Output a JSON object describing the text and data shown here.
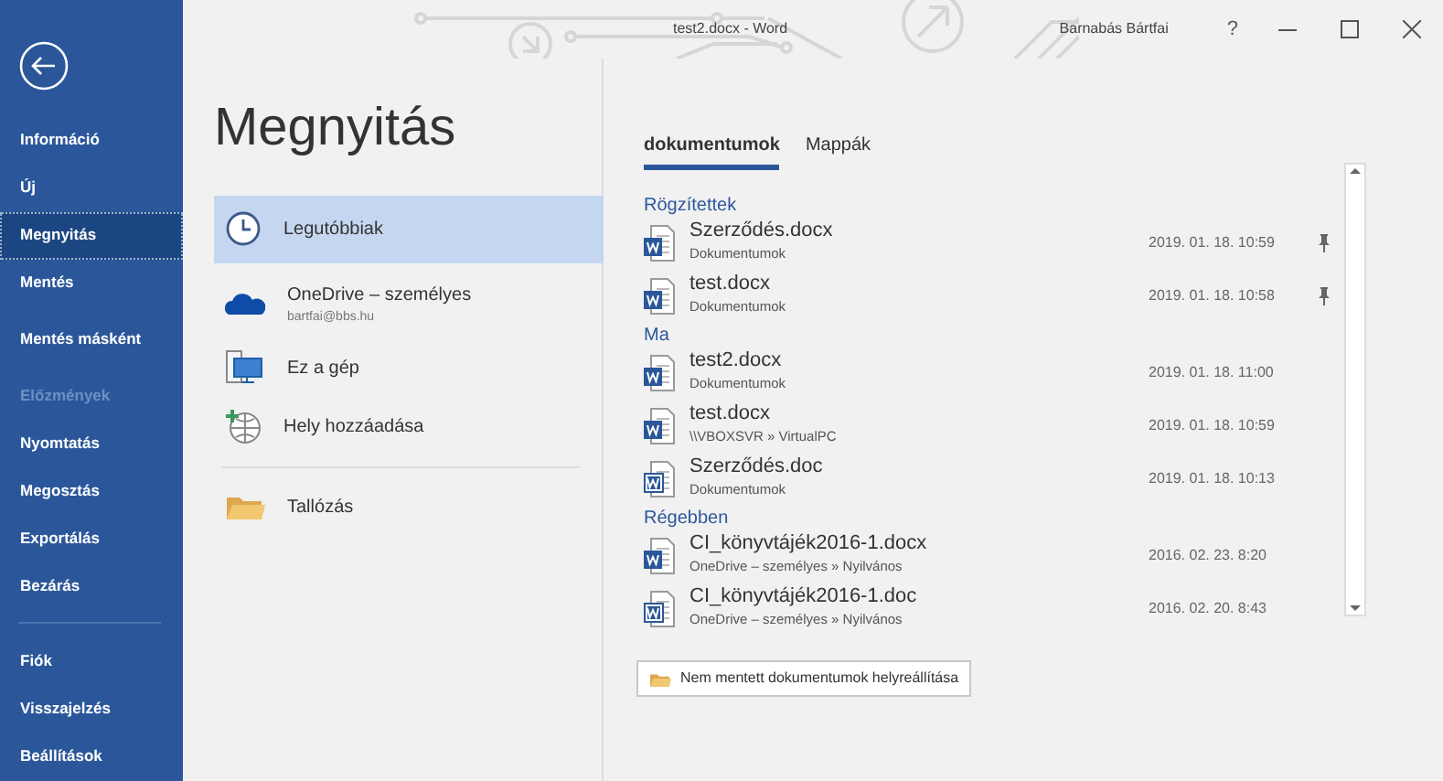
{
  "window": {
    "title": "test2.docx - Word",
    "user": "Barnabás Bártfai",
    "help": "?"
  },
  "sidebar": {
    "items": [
      {
        "label": "Információ",
        "selected": false,
        "disabled": false
      },
      {
        "label": "Új",
        "selected": false,
        "disabled": false
      },
      {
        "label": "Megnyitás",
        "selected": true,
        "disabled": false
      },
      {
        "label": "Mentés",
        "selected": false,
        "disabled": false
      },
      {
        "label": "Mentés másként",
        "selected": false,
        "disabled": false
      },
      {
        "label": "Előzmények",
        "selected": false,
        "disabled": true
      },
      {
        "label": "Nyomtatás",
        "selected": false,
        "disabled": false
      },
      {
        "label": "Megosztás",
        "selected": false,
        "disabled": false
      },
      {
        "label": "Exportálás",
        "selected": false,
        "disabled": false
      },
      {
        "label": "Bezárás",
        "selected": false,
        "disabled": false
      }
    ],
    "bottom_items": [
      {
        "label": "Fiók",
        "selected": false,
        "disabled": false
      },
      {
        "label": "Visszajelzés",
        "selected": false,
        "disabled": false
      },
      {
        "label": "Beállítások",
        "selected": false,
        "disabled": false
      }
    ]
  },
  "page_title": "Megnyitás",
  "places": [
    {
      "kind": "recent",
      "label": "Legutóbbiak",
      "selected": true
    },
    {
      "kind": "onedrive",
      "label": "OneDrive – személyes",
      "sublabel": "bartfai@bbs.hu",
      "selected": false
    },
    {
      "kind": "computer",
      "label": "Ez a gép",
      "selected": false
    },
    {
      "kind": "add-place",
      "label": "Hely hozzáadása",
      "selected": false
    }
  ],
  "browse": {
    "kind": "browse",
    "label": "Tallózás"
  },
  "tabs": [
    {
      "label": "dokumentumok",
      "selected": true
    },
    {
      "label": "Mappák",
      "selected": false
    }
  ],
  "groups": [
    {
      "title": "Rögzítettek",
      "files": [
        {
          "kind": "docx",
          "name": "Szerződés.docx",
          "location": "Dokumentumok",
          "date": "2019. 01. 18. 10:59",
          "pinned": true
        },
        {
          "kind": "docx",
          "name": "test.docx",
          "location": "Dokumentumok",
          "date": "2019. 01. 18. 10:58",
          "pinned": true
        }
      ]
    },
    {
      "title": "Ma",
      "files": [
        {
          "kind": "docx",
          "name": "test2.docx",
          "location": "Dokumentumok",
          "date": "2019. 01. 18. 11:00",
          "pinned": false
        },
        {
          "kind": "docx",
          "name": "test.docx",
          "location": "\\\\VBOXSVR » VirtualPC",
          "date": "2019. 01. 18. 10:59",
          "pinned": false
        },
        {
          "kind": "doc",
          "name": "Szerződés.doc",
          "location": "Dokumentumok",
          "date": "2019. 01. 18. 10:13",
          "pinned": false
        }
      ]
    },
    {
      "title": "Régebben",
      "files": [
        {
          "kind": "docx",
          "name": "CI_könyvtájék2016-1.docx",
          "location": "OneDrive – személyes » Nyilvános",
          "date": "2016. 02. 23. 8:20",
          "pinned": false
        },
        {
          "kind": "doc",
          "name": "CI_könyvtájék2016-1.doc",
          "location": "OneDrive – személyes » Nyilvános",
          "date": "2016. 02. 20. 8:43",
          "pinned": false
        }
      ]
    }
  ],
  "recover_button": "Nem mentett dokumentumok helyreállítása"
}
